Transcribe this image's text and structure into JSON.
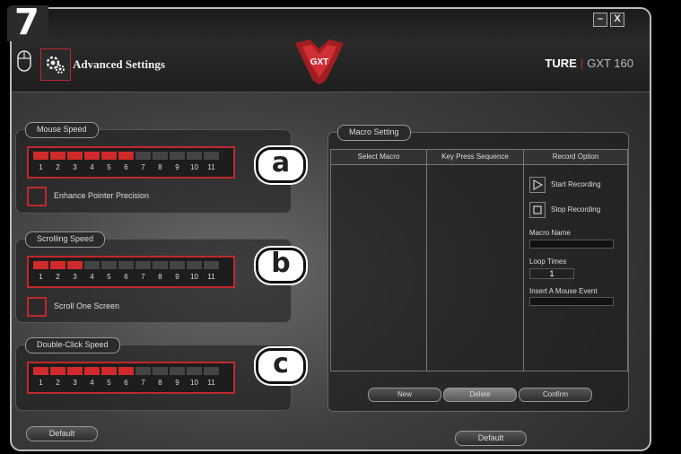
{
  "step_number": "7",
  "window": {
    "title": "Advanced Settings",
    "brand": "TURE",
    "separator": "|",
    "model": "GXT 160",
    "logo_text": "GXT",
    "minimize_label": "–",
    "close_label": "X"
  },
  "mouse_speed": {
    "label": "Mouse Speed",
    "scale": [
      "1",
      "2",
      "3",
      "4",
      "5",
      "6",
      "7",
      "8",
      "9",
      "10",
      "11"
    ],
    "level": 6,
    "checkbox_label": "Enhance Pointer Precision",
    "callout": "a"
  },
  "scrolling_speed": {
    "label": "Scrolling Speed",
    "scale": [
      "1",
      "2",
      "3",
      "4",
      "5",
      "6",
      "7",
      "8",
      "9",
      "10",
      "11"
    ],
    "level": 3,
    "checkbox_label": "Scroll One Screen",
    "callout": "b"
  },
  "double_click_speed": {
    "label": "Double-Click Speed",
    "scale": [
      "1",
      "2",
      "3",
      "4",
      "5",
      "6",
      "7",
      "8",
      "9",
      "10",
      "11"
    ],
    "level": 6,
    "callout": "c"
  },
  "left_default_label": "Default",
  "macro": {
    "label": "Macro Setting",
    "columns": [
      "Select Macro",
      "Key Press Sequence",
      "Record Option"
    ],
    "start_recording": "Start Recording",
    "stop_recording": "Stop Recording",
    "macro_name_label": "Macro Name",
    "loop_times_label": "Loop Times",
    "loop_times_value": "1",
    "insert_event_label": "Insert A Mouse Event",
    "buttons": {
      "new": "New",
      "delete": "Delete",
      "confirm": "Confirm"
    }
  },
  "bottom_default_label": "Default",
  "colors": {
    "accent": "#c0282d",
    "bar_on": "#d02a2a",
    "bar_off": "#444444"
  }
}
